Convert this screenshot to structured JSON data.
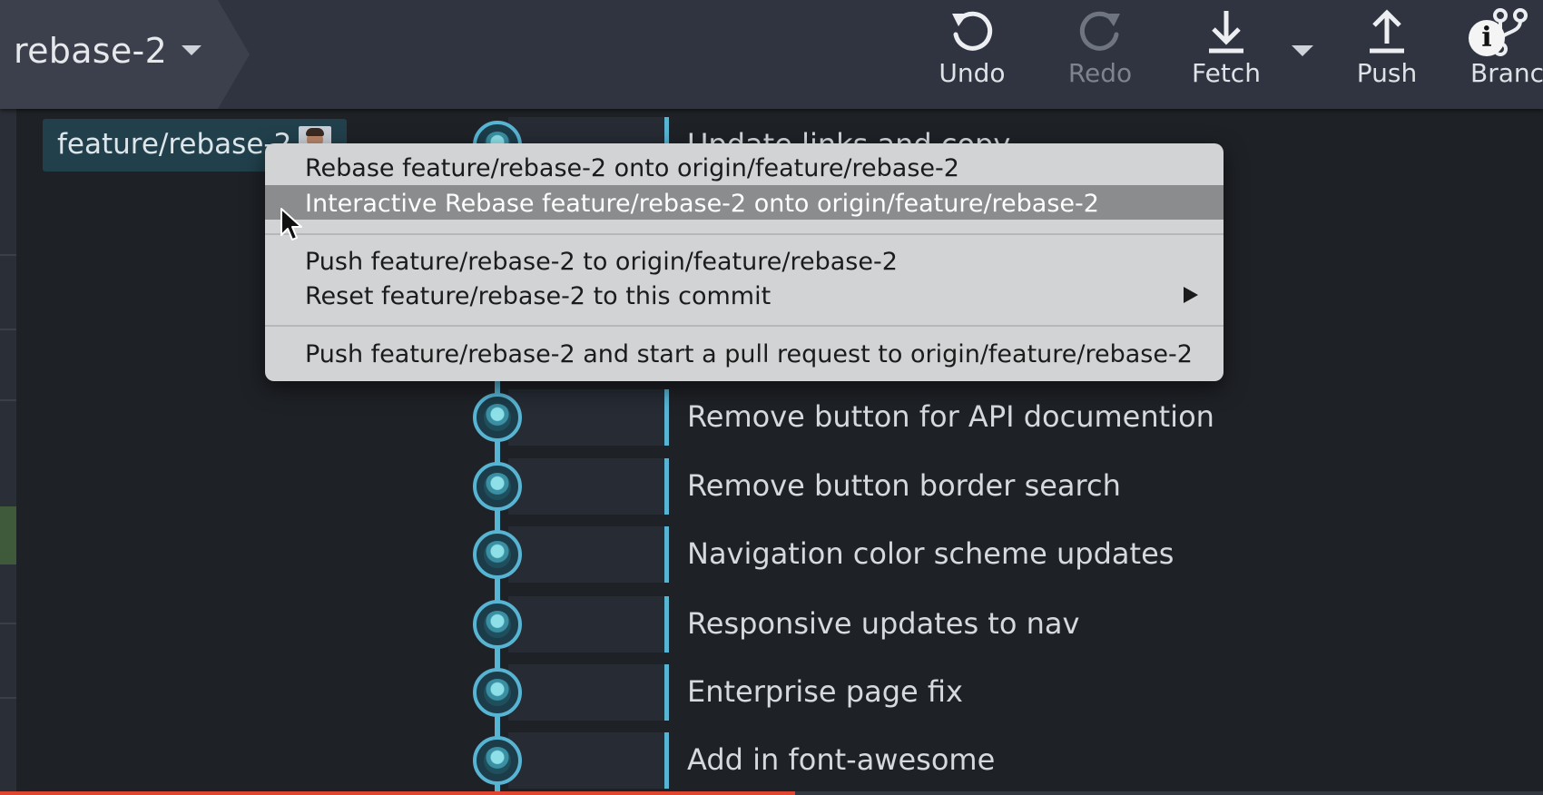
{
  "toolbar": {
    "repo_name": "rebase-2",
    "buttons": {
      "undo": "Undo",
      "redo": "Redo",
      "fetch": "Fetch",
      "push": "Push",
      "branch": "Branc"
    },
    "info_badge": "i"
  },
  "branch_label": {
    "name": "feature/rebase-2"
  },
  "commits": [
    {
      "message": "Update links and copy"
    },
    {
      "message": "Remove button for API documention"
    },
    {
      "message": "Remove button border search"
    },
    {
      "message": "Navigation color scheme updates"
    },
    {
      "message": "Responsive updates to nav"
    },
    {
      "message": "Enterprise page fix"
    },
    {
      "message": "Add in font-awesome"
    }
  ],
  "context_menu": {
    "items": [
      {
        "label": "Rebase feature/rebase-2 onto origin/feature/rebase-2"
      },
      {
        "label": "Interactive Rebase feature/rebase-2 onto origin/feature/rebase-2",
        "highlighted": true
      },
      {
        "label": "Push feature/rebase-2 to origin/feature/rebase-2"
      },
      {
        "label": "Reset feature/rebase-2 to this commit",
        "submenu": true
      },
      {
        "label": "Push feature/rebase-2 and start a pull request to origin/feature/rebase-2"
      }
    ]
  },
  "progress": {
    "fraction": 0.515
  },
  "colors": {
    "toolbar_bg": "#2f3440",
    "app_bg": "#1e2126",
    "graph_accent": "#58b4d3",
    "menu_bg": "#d2d3d5",
    "menu_highlight": "#8b8c8e",
    "progress_fill": "#e0452f"
  },
  "icons": {
    "undo": "undo-icon",
    "redo": "redo-icon",
    "fetch": "download-arrow-icon",
    "push": "upload-arrow-icon",
    "branch": "branch-icon",
    "info": "info-icon",
    "submenu": "chevron-right-icon",
    "cursor": "mouse-pointer-icon"
  }
}
